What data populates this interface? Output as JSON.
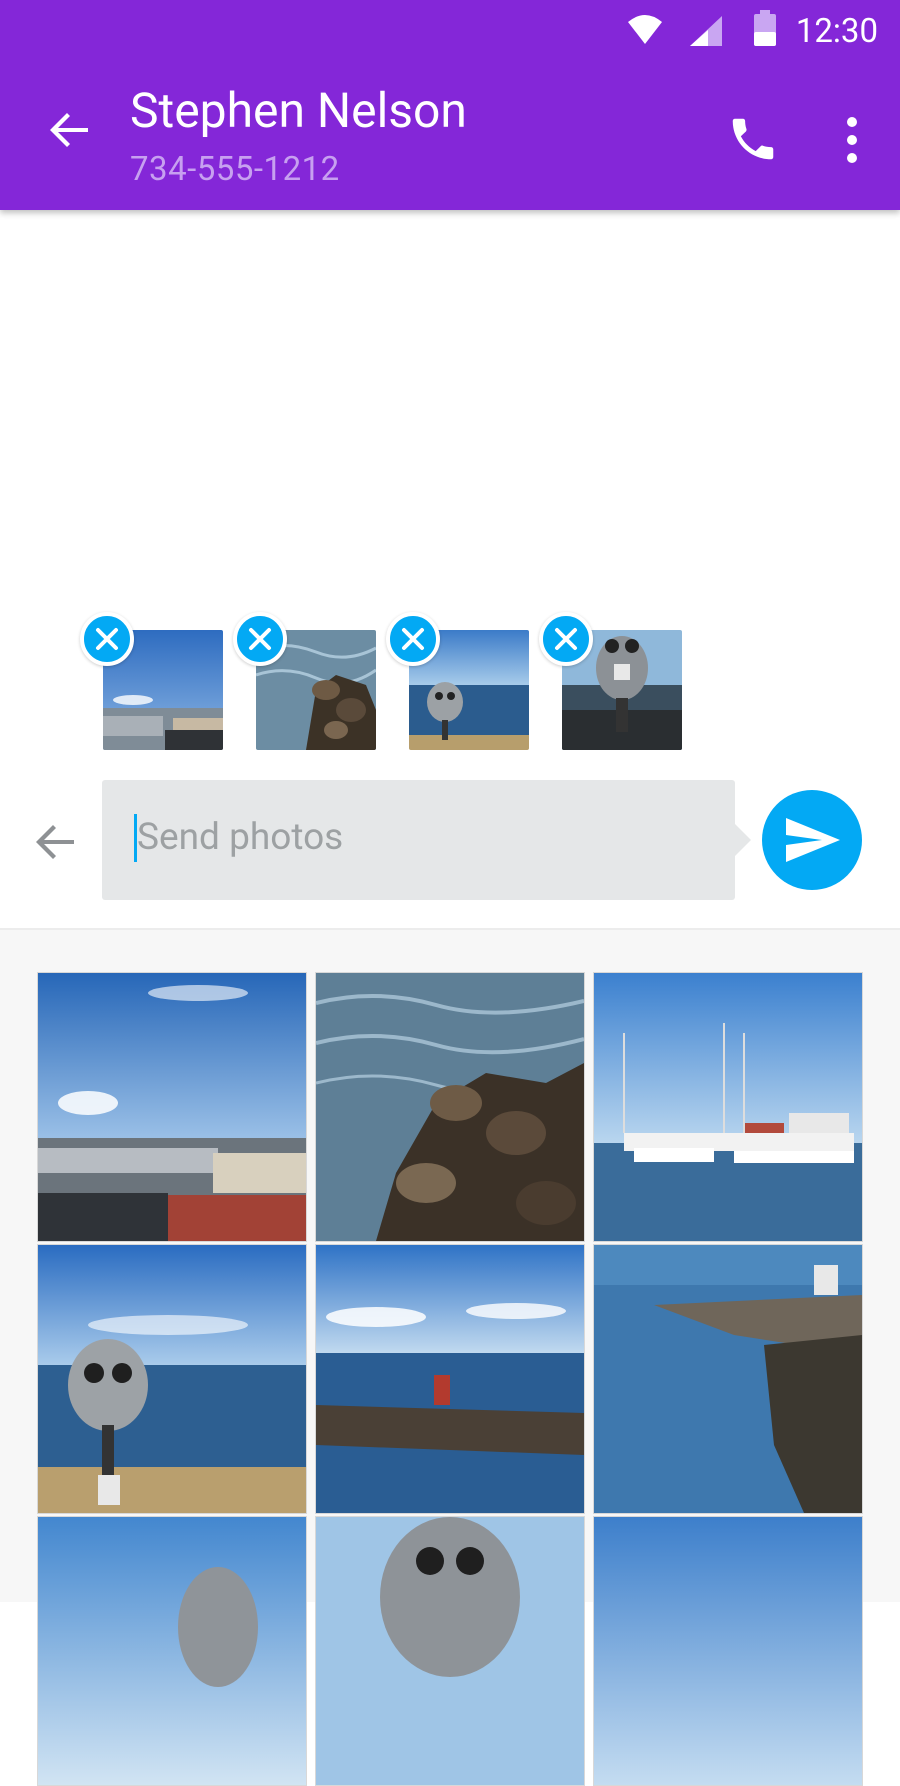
{
  "status_bar": {
    "time": "12:30"
  },
  "header": {
    "contact_name": "Stephen Nelson",
    "contact_phone": "734-555-1212"
  },
  "attachments": [
    {
      "id": "city"
    },
    {
      "id": "rocks"
    },
    {
      "id": "viewer-sea"
    },
    {
      "id": "viewer-close"
    }
  ],
  "compose": {
    "placeholder": "Send photos",
    "value": ""
  },
  "gallery": [
    {
      "scene": "city"
    },
    {
      "scene": "rocks"
    },
    {
      "scene": "marina"
    },
    {
      "scene": "viewer-sea"
    },
    {
      "scene": "jetty"
    },
    {
      "scene": "breakwater"
    },
    {
      "scene": "viewer-bottom"
    },
    {
      "scene": "viewer-top"
    },
    {
      "scene": "sky-sea"
    }
  ],
  "colors": {
    "app_bar": "#8427D8",
    "accent": "#03A9F4",
    "input_bg": "#E5E7E8"
  }
}
